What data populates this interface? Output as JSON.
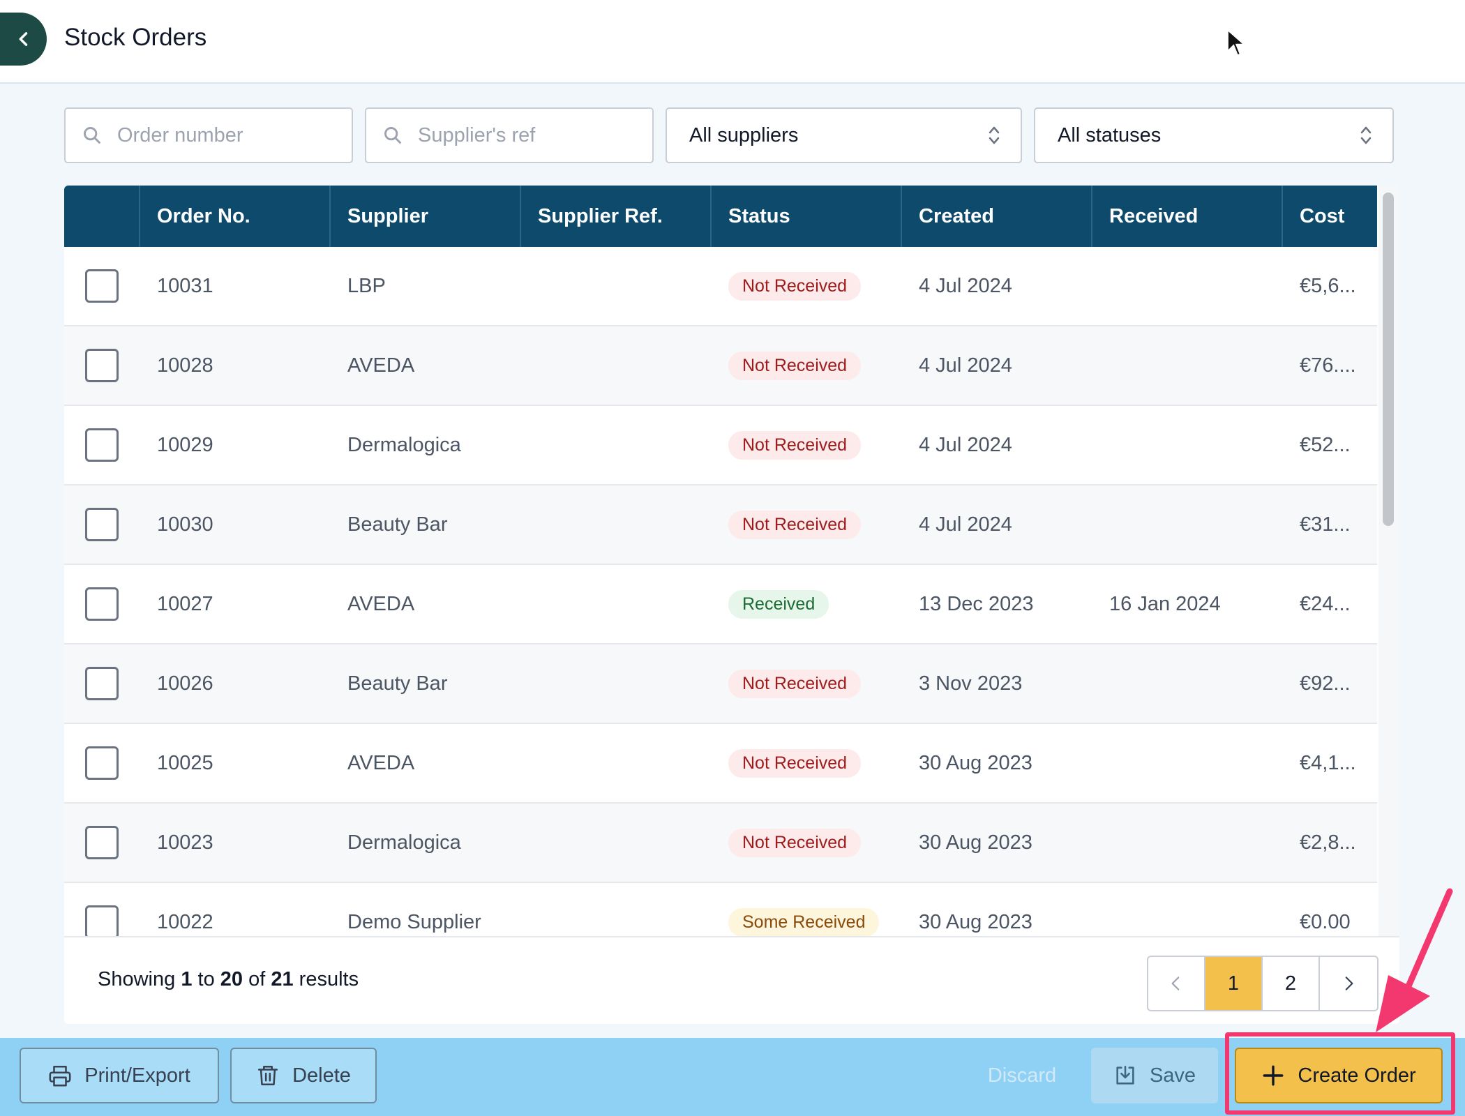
{
  "header": {
    "title": "Stock Orders",
    "back_icon": "chevron-left-icon"
  },
  "filters": {
    "order_number_placeholder": "Order number",
    "supplier_ref_placeholder": "Supplier's ref",
    "supplier_select": "All suppliers",
    "status_select": "All statuses"
  },
  "table": {
    "columns": [
      "",
      "Order No.",
      "Supplier",
      "Supplier Ref.",
      "Status",
      "Created",
      "Received",
      "Cost"
    ],
    "rows": [
      {
        "order": "10031",
        "supplier": "LBP",
        "ref": "",
        "status": "Not Received",
        "status_color": "red",
        "created": "4 Jul 2024",
        "received": "",
        "cost": "€5,6..."
      },
      {
        "order": "10028",
        "supplier": "AVEDA",
        "ref": "",
        "status": "Not Received",
        "status_color": "red",
        "created": "4 Jul 2024",
        "received": "",
        "cost": "€76...."
      },
      {
        "order": "10029",
        "supplier": "Dermalogica",
        "ref": "",
        "status": "Not Received",
        "status_color": "red",
        "created": "4 Jul 2024",
        "received": "",
        "cost": "€52..."
      },
      {
        "order": "10030",
        "supplier": "Beauty Bar",
        "ref": "",
        "status": "Not Received",
        "status_color": "red",
        "created": "4 Jul 2024",
        "received": "",
        "cost": "€31..."
      },
      {
        "order": "10027",
        "supplier": "AVEDA",
        "ref": "",
        "status": "Received",
        "status_color": "green",
        "created": "13 Dec 2023",
        "received": "16 Jan 2024",
        "cost": "€24..."
      },
      {
        "order": "10026",
        "supplier": "Beauty Bar",
        "ref": "",
        "status": "Not Received",
        "status_color": "red",
        "created": "3 Nov 2023",
        "received": "",
        "cost": "€92..."
      },
      {
        "order": "10025",
        "supplier": "AVEDA",
        "ref": "",
        "status": "Not Received",
        "status_color": "red",
        "created": "30 Aug 2023",
        "received": "",
        "cost": "€4,1..."
      },
      {
        "order": "10023",
        "supplier": "Dermalogica",
        "ref": "",
        "status": "Not Received",
        "status_color": "red",
        "created": "30 Aug 2023",
        "received": "",
        "cost": "€2,8..."
      },
      {
        "order": "10022",
        "supplier": "Demo Supplier",
        "ref": "",
        "status": "Some Received",
        "status_color": "yellow",
        "created": "30 Aug 2023",
        "received": "",
        "cost": "€0.00"
      }
    ]
  },
  "footer": {
    "showing": "Showing",
    "from": "1",
    "to_word": "to",
    "to": "20",
    "of_word": "of",
    "total": "21",
    "results_word": "results",
    "pages": [
      "1",
      "2"
    ],
    "current_page": "1"
  },
  "toolbar": {
    "print_label": "Print/Export",
    "delete_label": "Delete",
    "discard_label": "Discard",
    "save_label": "Save",
    "create_label": "Create Order"
  },
  "colors": {
    "header_bg": "#0d4a6c",
    "accent": "#f3c14b",
    "toolbar_bg": "#8fd0f5",
    "highlight": "#f2386f"
  }
}
